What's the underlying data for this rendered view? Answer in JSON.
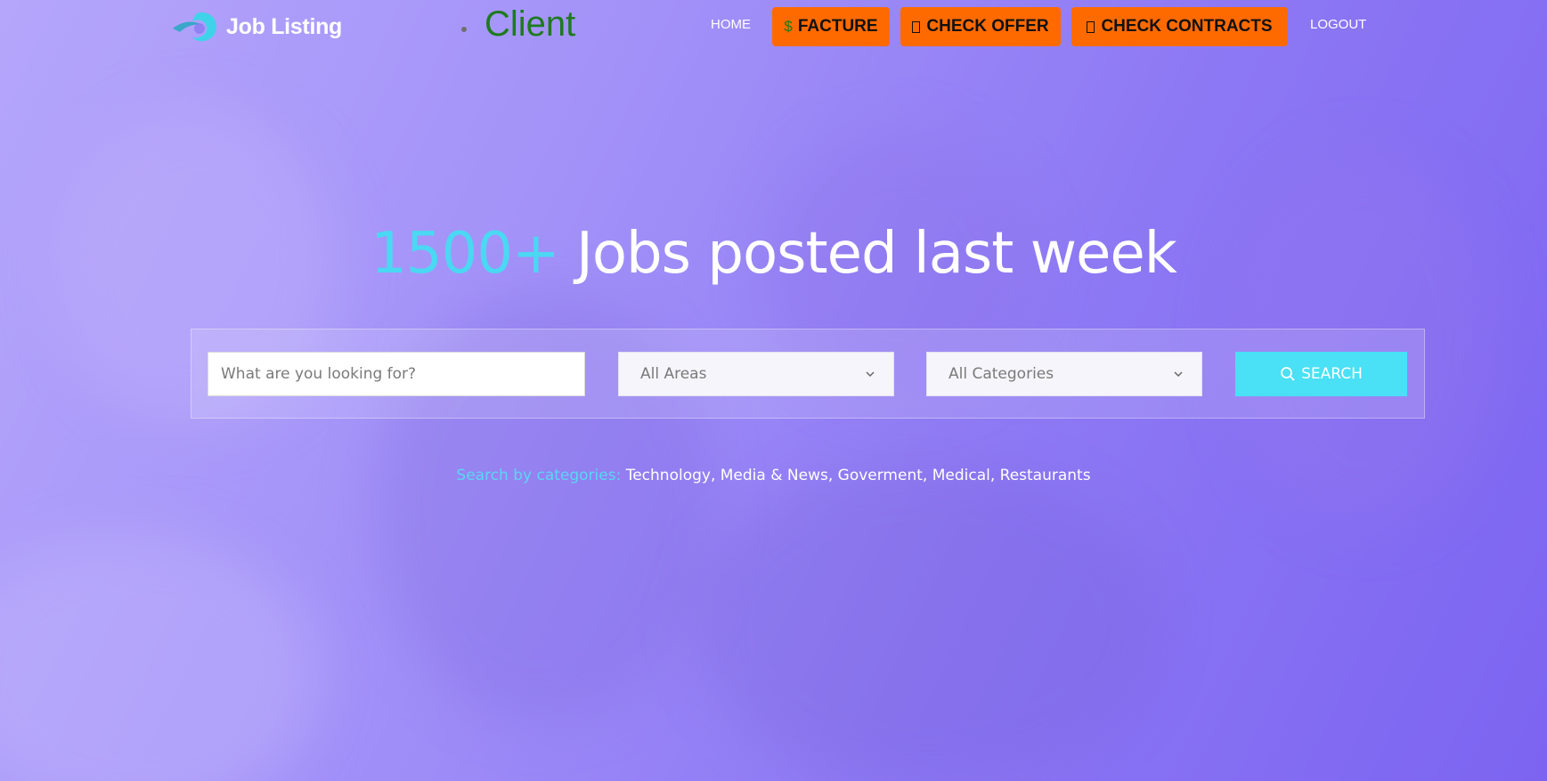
{
  "header": {
    "logo_text": "Job Listing",
    "role_label": "Client",
    "nav": {
      "home": "HOME",
      "facture_glyph": "$",
      "facture": "FACTURE",
      "check_offer": "CHECK OFFER",
      "check_contracts": "CHECK CONTRACTS",
      "logout": "LOGOUT"
    }
  },
  "hero": {
    "highlight": "1500+",
    "title_rest": " Jobs posted last week"
  },
  "search": {
    "placeholder": "What are you looking for?",
    "areas_value": "All Areas",
    "categories_value": "All Categories",
    "button_label": "SEARCH"
  },
  "categories": {
    "label": "Search by categories:",
    "items": [
      "Technology",
      "Media & News",
      "Goverment",
      "Medical",
      "Restaurants"
    ]
  },
  "colors": {
    "accent": "#4ad8f3",
    "nav_button": "#ff6a00",
    "role_text": "#1f7a1f",
    "search_button": "#4ae0f5"
  },
  "icons": {
    "logo": "logo-swoosh-icon",
    "search": "search-icon",
    "dropdown": "chevron-down-icon"
  }
}
